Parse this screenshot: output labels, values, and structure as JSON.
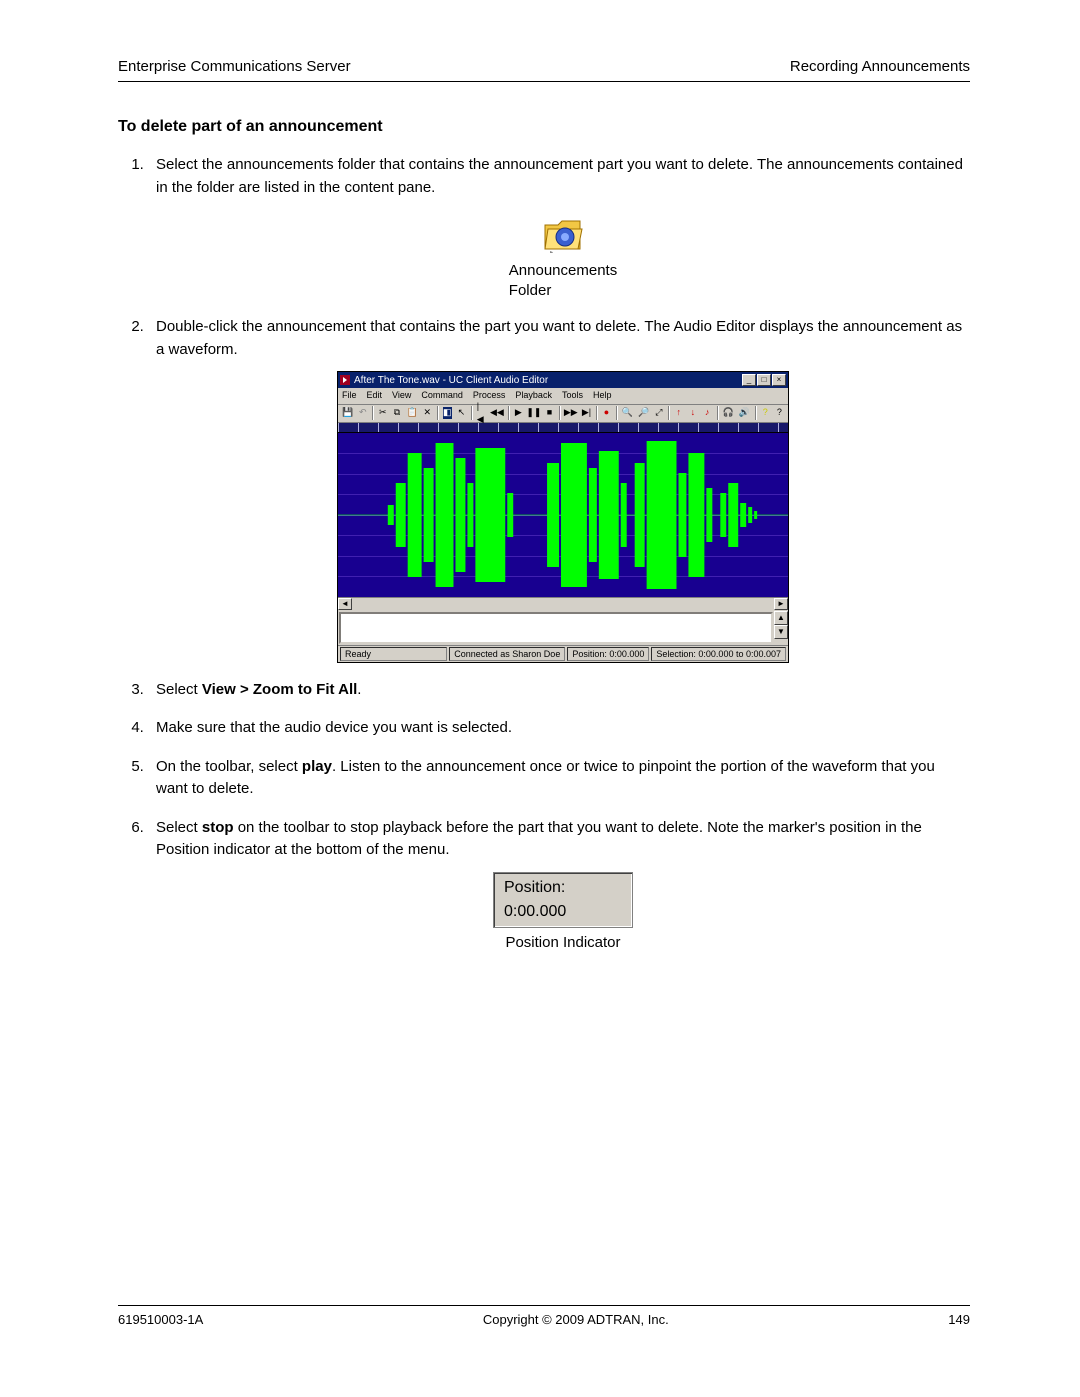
{
  "header": {
    "left": "Enterprise Communications Server",
    "right": "Recording Announcements"
  },
  "section_title": "To delete part of an announcement",
  "steps": {
    "s1": "Select the announcements folder that contains the announcement part you want to delete. The announcements contained in the folder are listed in the content pane.",
    "s2": "Double-click the announcement that contains the part you want to delete. The Audio Editor displays the announcement as a waveform.",
    "s3_pre": "Select ",
    "s3_bold": "View > Zoom to Fit All",
    "s3_post": ".",
    "s4": "Make sure that the audio device you want is selected.",
    "s5_pre": "On the toolbar, select ",
    "s5_bold": "play",
    "s5_post": ". Listen to the announcement once or twice to pinpoint the portion of the waveform that you want to delete.",
    "s6_pre": "Select ",
    "s6_bold": "stop",
    "s6_post": " on the toolbar to stop playback before the part that you want to delete. Note the marker's position in the Position indicator at the bottom of the menu."
  },
  "folder": {
    "label": "Announcements\nFolder"
  },
  "app": {
    "title": "After The Tone.wav - UC Client Audio Editor",
    "menus": [
      "File",
      "Edit",
      "View",
      "Command",
      "Process",
      "Playback",
      "Tools",
      "Help"
    ],
    "status": {
      "ready": "Ready",
      "conn": "Connected as Sharon Doe",
      "pos": "Position: 0:00.000",
      "sel": "Selection: 0:00.000 to 0:00.007"
    }
  },
  "pos_indicator": {
    "value": "Position: 0:00.000",
    "label": "Position Indicator"
  },
  "footer": {
    "left": "619510003-1A",
    "center": "Copyright © 2009 ADTRAN, Inc.",
    "right": "149"
  }
}
